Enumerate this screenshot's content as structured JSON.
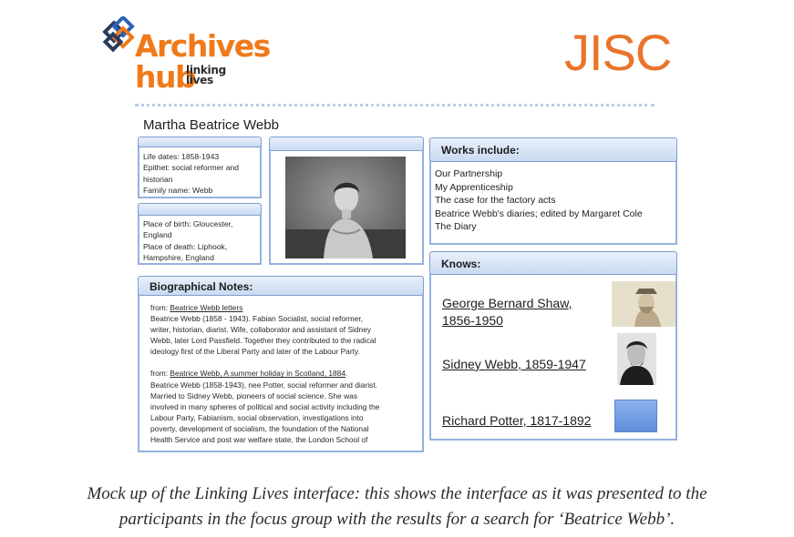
{
  "header": {
    "logo": {
      "line1": "Archives",
      "line2": "hub",
      "sub1": "linking",
      "sub2": "lives",
      "mark_icon": "interlocking-squares-icon",
      "brand_color": "#f07a1a"
    },
    "partner_logo": {
      "text": "JISC",
      "color": "#e8752b"
    }
  },
  "person_name": "Martha Beatrice Webb",
  "life_panel": {
    "lines": [
      "Life dates: 1858-1943",
      "Epithet: social reformer and",
      "historian",
      "Family name: Webb"
    ]
  },
  "place_panel": {
    "lines": [
      "Place of birth: Gloucester,",
      "England",
      "Place of death: Liphook,",
      "Hampshire, England"
    ]
  },
  "portrait": {
    "alt": "portrait-photo"
  },
  "works": {
    "title": "Works include:",
    "items": [
      "Our Partnership",
      "My Apprenticeship",
      "The case for the factory acts",
      "Beatrice Webb's diaries; edited by Margaret Cole",
      "The Diary"
    ]
  },
  "knows": {
    "title": "Knows:",
    "people": [
      {
        "name_line1": "George Bernard Shaw,",
        "name_line2": "1856-1950",
        "photo": "sepia-portrait"
      },
      {
        "name": "Sidney Webb, 1859-1947",
        "photo": "bw-portrait"
      },
      {
        "name": "Richard Potter, 1817-1892",
        "photo": "placeholder-blue"
      }
    ]
  },
  "bio": {
    "title": "Biographical Notes:",
    "entry1": {
      "from": "from:",
      "source": "Beatrice Webb letters",
      "lines": [
        "Beatrice Webb (1858 - 1943). Fabian Socialist, social reformer,",
        "writer, historian, diarist. Wife, collaborator and assistant of Sidney",
        "Webb, later Lord Passfield. Together they contributed to the radical",
        "ideology first of the Liberal Party and later of the Labour Party."
      ]
    },
    "entry2": {
      "from": "from:",
      "source": "Beatrice Webb, A summer holiday in Scotland, 1884",
      "source_suffix": ".",
      "lines": [
        "Beatrice Webb (1858-1943), nee Potter, social reformer and diarist.",
        "Married to Sidney Webb, pioneers of social science. She was",
        "involved in many spheres of political and social activity including the",
        "Labour Party, Fabianism, social observation, investigations into",
        "poverty, development of socialism, the foundation of the National",
        "Health Service and post war welfare state, the London School of"
      ]
    }
  },
  "caption": {
    "line1": "Mock up of the Linking Lives interface: this shows the interface as it was presented to the",
    "line2": "participants in the focus group with the results for a search for ‘Beatrice Webb’."
  },
  "colors": {
    "panel_border": "#93b3dd",
    "tab_fill": "#c9daf1",
    "placeholder_blue": "#6f9be0"
  }
}
